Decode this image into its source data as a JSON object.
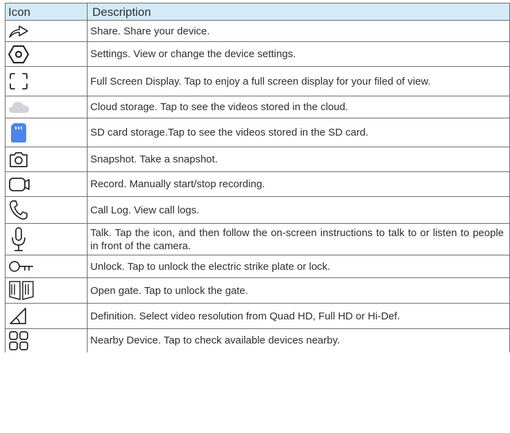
{
  "header": {
    "icon": "Icon",
    "description": "Description"
  },
  "rows": [
    {
      "icon": "share-icon",
      "description": "Share. Share your device."
    },
    {
      "icon": "settings-icon",
      "description": "Settings. View or change the device settings."
    },
    {
      "icon": "full-screen-icon",
      "description": "Full Screen Display. Tap to enjoy a full screen display for your filed of view."
    },
    {
      "icon": "cloud-icon",
      "description": "Cloud storage. Tap to see the videos stored in the cloud."
    },
    {
      "icon": "sd-card-icon",
      "description": "SD card storage.Tap to see the videos stored in the SD card."
    },
    {
      "icon": "camera-icon",
      "description": "Snapshot. Take a snapshot."
    },
    {
      "icon": "video-camera-icon",
      "description": "Record. Manually start/stop recording."
    },
    {
      "icon": "phone-icon",
      "description": "Call Log. View call logs."
    },
    {
      "icon": "microphone-icon",
      "description": "Talk. Tap the icon, and then follow the on-screen instructions to talk to or listen to people in front of the camera."
    },
    {
      "icon": "key-icon",
      "description": "Unlock. Tap to unlock the electric strike plate or lock."
    },
    {
      "icon": "gate-icon",
      "description": "Open gate. Tap to unlock the gate."
    },
    {
      "icon": "definition-icon",
      "description": "Definition. Select video resolution from Quad HD, Full HD or Hi-Def."
    },
    {
      "icon": "nearby-device-icon",
      "description": "Nearby Device. Tap to check available devices nearby."
    }
  ],
  "colors": {
    "header_bg": "#d4eaf7",
    "border": "#6b6b6b",
    "sd_card": "#4d84f0",
    "cloud": "#cfd3d9"
  }
}
